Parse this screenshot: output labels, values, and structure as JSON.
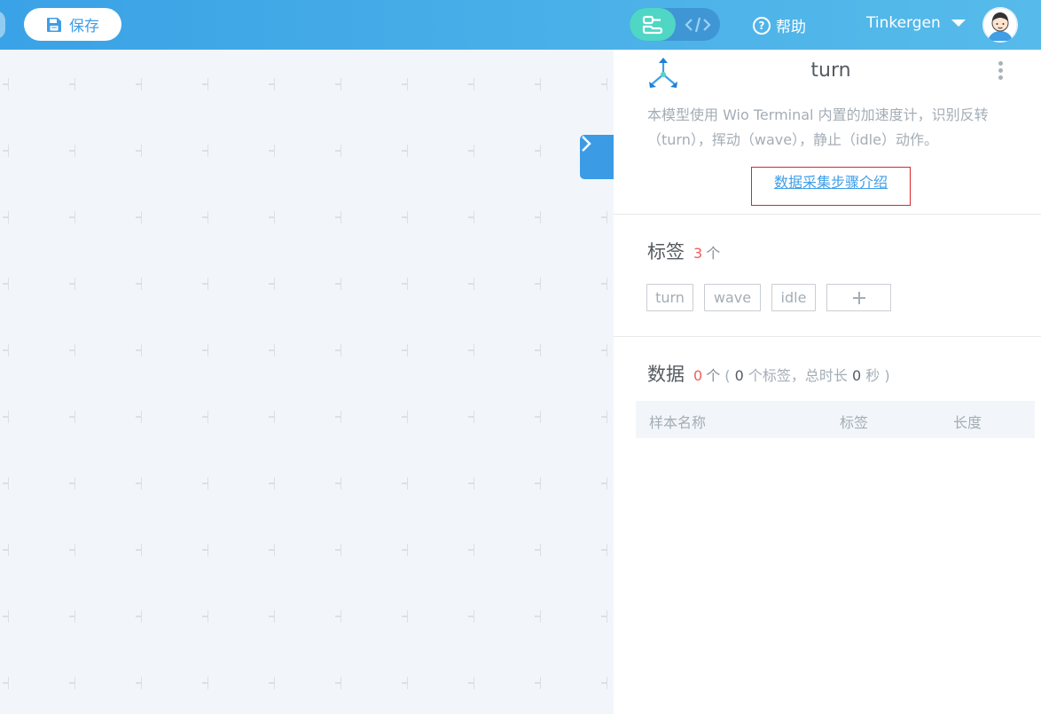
{
  "toolbar": {
    "save_label": "保存",
    "help_label": "帮助",
    "username": "Tinkergen"
  },
  "model": {
    "title": "turn",
    "description": "本模型使用 Wio Terminal 内置的加速度计，识别反转（turn），挥动（wave），静止（idle）动作。",
    "guide_link": "数据采集步骤介绍"
  },
  "labels_section": {
    "title": "标签",
    "count": "3",
    "unit": "个",
    "tags": [
      "turn",
      "wave",
      "idle"
    ]
  },
  "data_section": {
    "title": "数据",
    "count": "0",
    "unit": "个",
    "meta_open": "( ",
    "label_count": "0",
    "meta_labels": " 个标签，总时长 ",
    "duration": "0",
    "meta_seconds": " 秒 )",
    "columns": [
      "样本名称",
      "标签",
      "长度"
    ]
  },
  "colors": {
    "topbar": "#3aa2e6",
    "accent": "#3f9ee6",
    "toggle_active": "#4fd6c4",
    "count_red": "#f35c5c",
    "highlight_border": "#d9262b"
  },
  "icons": {
    "save": "floppy-disk-icon",
    "blocks_mode": "blocks-icon",
    "code_mode": "code-brackets-icon",
    "help": "question-circle-icon",
    "dropdown": "caret-down-icon",
    "collapse": "chevron-right-icon",
    "model": "three-arrows-icon",
    "more": "more-vertical-icon",
    "add_tag": "plus-icon"
  }
}
